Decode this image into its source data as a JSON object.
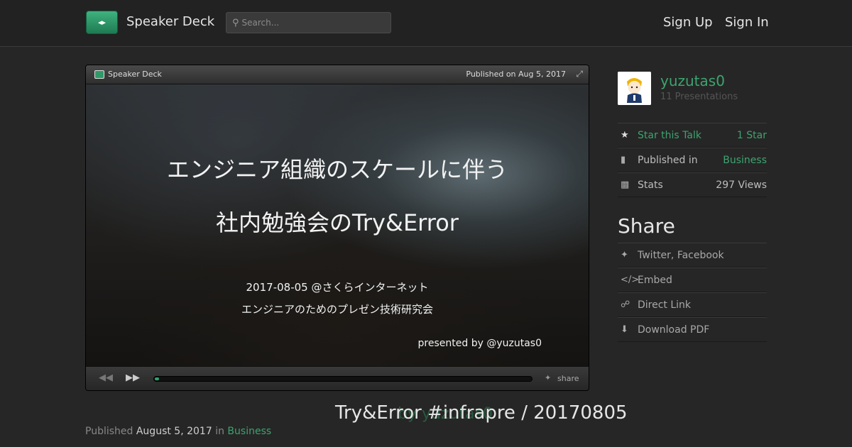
{
  "header": {
    "brand": "Speaker Deck",
    "search_placeholder": "Search...",
    "sign_up": "Sign Up",
    "sign_in": "Sign In"
  },
  "player": {
    "brand": "Speaker Deck",
    "published": "Published on Aug 5, 2017",
    "progress": 0.01,
    "share_label": "share"
  },
  "slide": {
    "title_line1": "エンジニア組織のスケールに伴う",
    "title_line2": "社内勉強会のTry&Error",
    "subtitle_line1": "2017-08-05 @さくらインターネット",
    "subtitle_line2": "エンジニアのためのプレゼン技術研究会",
    "presenter": "presented by @yuzutas0"
  },
  "author": {
    "name": "yuzutas0",
    "presentations": "11 Presentations"
  },
  "stats": {
    "star_label": "Star this Talk",
    "star_count": "1 Star",
    "published_label": "Published in",
    "category": "Business",
    "stats_label": "Stats",
    "views": "297 Views"
  },
  "share": {
    "heading": "Share",
    "twitter": "Twitter, Facebook",
    "embed": "Embed",
    "direct_link": "Direct Link",
    "download": "Download PDF"
  },
  "talk": {
    "title": "Try&Error #infrapre / 20170805",
    "by_author": "by yuzutas0",
    "published_prefix": "Published",
    "published_date": "August 5, 2017",
    "in_word": "in",
    "category": "Business"
  },
  "colors": {
    "accent": "#3ea36f",
    "background": "#262626"
  }
}
